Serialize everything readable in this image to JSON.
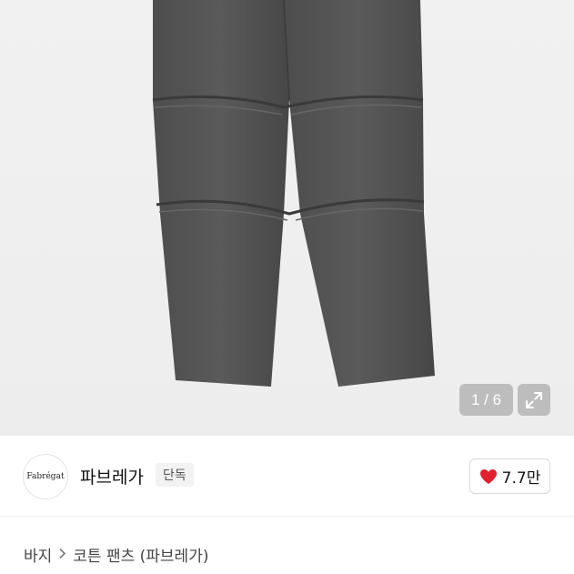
{
  "gallery": {
    "counter": "1 / 6",
    "expand_icon": "expand-arrows-icon"
  },
  "brand": {
    "logo_text": "Fabrégat",
    "name": "파브레가",
    "badge": "단독"
  },
  "like": {
    "icon": "heart-icon",
    "color": "#e0202e",
    "count": "7.7만"
  },
  "breadcrumb": {
    "category": "바지",
    "separator_icon": "chevron-right-icon",
    "product": "코튼 팬츠 (파브레가)"
  }
}
